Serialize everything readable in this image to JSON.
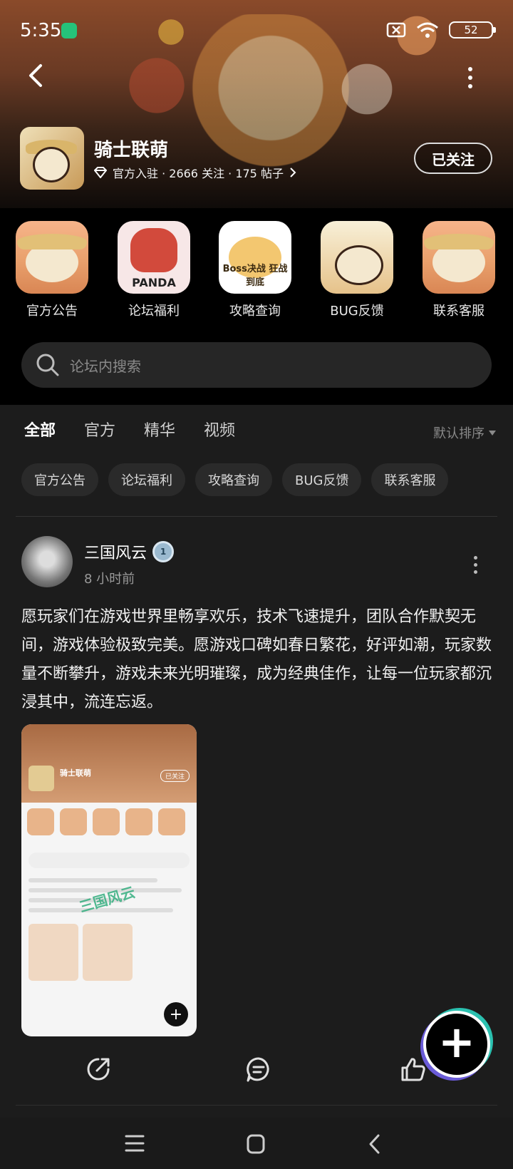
{
  "status_bar": {
    "time": "5:35",
    "battery": "52"
  },
  "forum": {
    "name": "骑士联萌",
    "meta": "官方入驻 · 2666 关注 · 175 帖子",
    "follow_label": "已关注"
  },
  "categories": [
    {
      "label": "官方公告",
      "icon": "panda-knight-icon"
    },
    {
      "label": "论坛福利",
      "icon": "panda-dragon-icon",
      "text": "PANDA"
    },
    {
      "label": "攻略查询",
      "icon": "boss-panda-icon",
      "text": "Boss决战 狂战到底"
    },
    {
      "label": "BUG反馈",
      "icon": "panda-sword-icon"
    },
    {
      "label": "联系客服",
      "icon": "panda-knight-icon"
    }
  ],
  "search": {
    "placeholder": "论坛内搜索"
  },
  "tabs": [
    {
      "label": "全部",
      "active": true
    },
    {
      "label": "官方"
    },
    {
      "label": "精华"
    },
    {
      "label": "视频"
    }
  ],
  "sort_label": "默认排序",
  "chips": [
    "官方公告",
    "论坛福利",
    "攻略查询",
    "BUG反馈",
    "联系客服"
  ],
  "post": {
    "user": "三国风云",
    "badge": "1",
    "time": "8 小时前",
    "text": "愿玩家们在游戏世界里畅享欢乐，技术飞速提升，团队合作默契无间，游戏体验极致完美。愿游戏口碑如春日繁花，好评如潮，玩家数量不断攀升，游戏未来光明璀璨，成为经典佳作，让每一位玩家都沉浸其中，流连忘返。",
    "image": {
      "mini_title": "骑士联萌",
      "mini_follow": "已关注",
      "watermark": "三国风云"
    }
  },
  "colors": {
    "accent": "#17b6a5",
    "background": "#1c1c1c"
  }
}
